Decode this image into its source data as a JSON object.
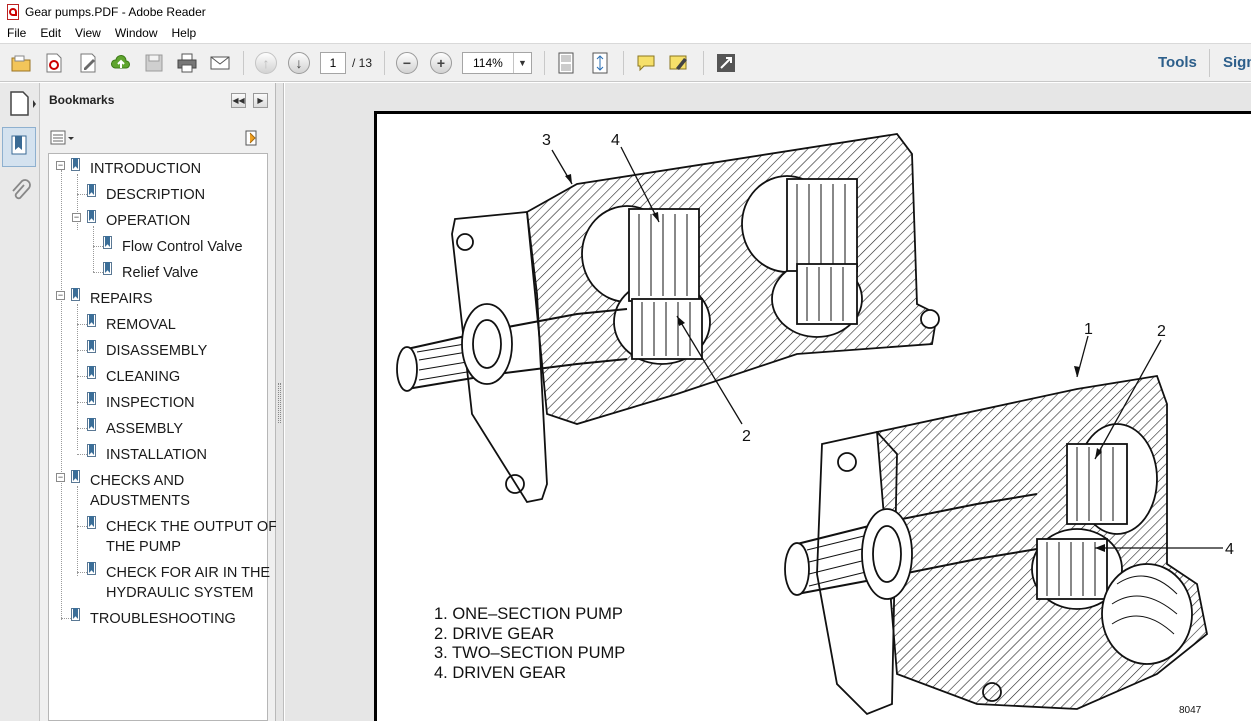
{
  "window": {
    "title": "Gear pumps.PDF - Adobe Reader"
  },
  "menu": [
    "File",
    "Edit",
    "View",
    "Window",
    "Help"
  ],
  "toolbar": {
    "page_current": "1",
    "page_total": "/ 13",
    "zoom": "114%",
    "tools_label": "Tools",
    "sign_label": "Sign"
  },
  "bookmarks_panel": {
    "title": "Bookmarks",
    "items": [
      {
        "label": "INTRODUCTION",
        "level": 0,
        "expanded": true
      },
      {
        "label": "DESCRIPTION",
        "level": 1
      },
      {
        "label": "OPERATION",
        "level": 1,
        "expanded": true
      },
      {
        "label": "Flow Control Valve",
        "level": 2
      },
      {
        "label": "Relief Valve",
        "level": 2
      },
      {
        "label": "REPAIRS",
        "level": 0,
        "expanded": true
      },
      {
        "label": "REMOVAL",
        "level": 1
      },
      {
        "label": "DISASSEMBLY",
        "level": 1
      },
      {
        "label": "CLEANING",
        "level": 1
      },
      {
        "label": "INSPECTION",
        "level": 1
      },
      {
        "label": "ASSEMBLY",
        "level": 1
      },
      {
        "label": "INSTALLATION",
        "level": 1
      },
      {
        "label": "CHECKS AND",
        "label2": "ADUSTMENTS",
        "level": 0,
        "expanded": true
      },
      {
        "label": "CHECK THE OUTPUT OF",
        "label2": "THE PUMP",
        "level": 1
      },
      {
        "label": "CHECK FOR AIR IN THE",
        "label2": "HYDRAULIC SYSTEM",
        "level": 1
      },
      {
        "label": "TROUBLESHOOTING",
        "level": 0
      }
    ]
  },
  "document": {
    "callouts": [
      "3",
      "4",
      "2",
      "1",
      "2",
      "4"
    ],
    "legend": [
      "1.  ONE–SECTION PUMP",
      "2.  DRIVE GEAR",
      "3.  TWO–SECTION PUMP",
      "4.  DRIVEN GEAR"
    ],
    "figure_number": "8047"
  }
}
